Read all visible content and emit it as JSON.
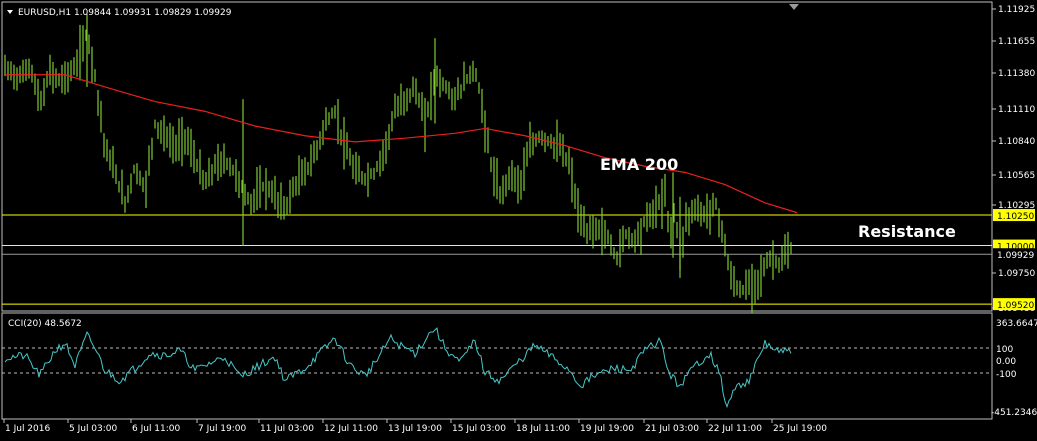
{
  "header": {
    "symbol_line": "EURUSD,H1  1.09844 1.09931 1.09829 1.09929"
  },
  "indicator": {
    "label": "CCI(20) 48.5672",
    "levels": [
      "100",
      "0.00",
      "-100"
    ],
    "scale_top": "363.6647",
    "scale_bottom": "-451.2346"
  },
  "annotations": {
    "ema": "EMA 200",
    "resistance": "Resistance"
  },
  "price_axis": {
    "ticks": [
      "1.11925",
      "1.11655",
      "1.11380",
      "1.11110",
      "1.10840",
      "1.10565",
      "1.10295",
      "1.09750",
      "1.09480"
    ],
    "highlight_labels": [
      {
        "text": "1.10250",
        "value": 1.1025
      },
      {
        "text": "1.10000",
        "value": 1.1
      },
      {
        "text": "1.09520",
        "value": 1.0952
      }
    ],
    "current_label": {
      "text": "1.09929",
      "value": 1.09929
    }
  },
  "time_axis": {
    "labels": [
      "1 Jul 2016",
      "5 Jul 03:00",
      "6 Jul 11:00",
      "7 Jul 19:00",
      "11 Jul 03:00",
      "12 Jul 11:00",
      "13 Jul 19:00",
      "15 Jul 03:00",
      "18 Jul 11:00",
      "19 Jul 19:00",
      "21 Jul 03:00",
      "22 Jul 11:00",
      "25 Jul 19:00"
    ]
  },
  "colors": {
    "background": "#000000",
    "candles": "#7FC832",
    "ema": "#E8201E",
    "level_lines": "#FFFF00",
    "current_line": "#9A9A9A",
    "cci": "#46C8C8",
    "text": "#FFFFFF",
    "grid_border": "#C0C0C0"
  },
  "chart_data": {
    "type": "line",
    "price_range": [
      1.0948,
      1.1198
    ],
    "horizontal_levels": [
      1.1025,
      1.1,
      1.0952
    ],
    "current_price": 1.09929,
    "price_path": [
      [
        0,
        1.1145
      ],
      [
        15,
        1.1138
      ],
      [
        25,
        1.1148
      ],
      [
        35,
        1.1115
      ],
      [
        45,
        1.1142
      ],
      [
        55,
        1.1135
      ],
      [
        70,
        1.1145
      ],
      [
        82,
        1.1175
      ],
      [
        90,
        1.114
      ],
      [
        100,
        1.108
      ],
      [
        110,
        1.106
      ],
      [
        120,
        1.1035
      ],
      [
        130,
        1.1065
      ],
      [
        140,
        1.1045
      ],
      [
        150,
        1.11
      ],
      [
        160,
        1.109
      ],
      [
        170,
        1.108
      ],
      [
        180,
        1.109
      ],
      [
        190,
        1.107
      ],
      [
        200,
        1.105
      ],
      [
        210,
        1.1065
      ],
      [
        220,
        1.107
      ],
      [
        230,
        1.106
      ],
      [
        238,
        1.1045
      ],
      [
        245,
        1.1035
      ],
      [
        260,
        1.105
      ],
      [
        270,
        1.104
      ],
      [
        280,
        1.103
      ],
      [
        290,
        1.105
      ],
      [
        300,
        1.106
      ],
      [
        310,
        1.1075
      ],
      [
        320,
        1.11
      ],
      [
        330,
        1.111
      ],
      [
        340,
        1.108
      ],
      [
        350,
        1.106
      ],
      [
        360,
        1.1055
      ],
      [
        370,
        1.106
      ],
      [
        380,
        1.108
      ],
      [
        390,
        1.111
      ],
      [
        400,
        1.112
      ],
      [
        410,
        1.113
      ],
      [
        420,
        1.11
      ],
      [
        430,
        1.114
      ],
      [
        440,
        1.113
      ],
      [
        450,
        1.112
      ],
      [
        460,
        1.1135
      ],
      [
        470,
        1.1145
      ],
      [
        478,
        1.111
      ],
      [
        485,
        1.107
      ],
      [
        495,
        1.104
      ],
      [
        505,
        1.106
      ],
      [
        515,
        1.105
      ],
      [
        525,
        1.108
      ],
      [
        535,
        1.109
      ],
      [
        545,
        1.1085
      ],
      [
        555,
        1.108
      ],
      [
        565,
        1.1065
      ],
      [
        572,
        1.103
      ],
      [
        580,
        1.101
      ],
      [
        590,
        1.1015
      ],
      [
        600,
        1.101
      ],
      [
        612,
        1.099
      ],
      [
        620,
        1.101
      ],
      [
        630,
        1.1005
      ],
      [
        640,
        1.102
      ],
      [
        650,
        1.103
      ],
      [
        660,
        1.104
      ],
      [
        665,
        1.101
      ],
      [
        670,
        1.103
      ],
      [
        675,
        1.099
      ],
      [
        680,
        1.102
      ],
      [
        690,
        1.103
      ],
      [
        700,
        1.1025
      ],
      [
        710,
        1.1035
      ],
      [
        718,
        1.101
      ],
      [
        725,
        1.0975
      ],
      [
        735,
        1.0962
      ],
      [
        745,
        1.0968
      ],
      [
        755,
        1.0975
      ],
      [
        765,
        1.099
      ],
      [
        775,
        1.0985
      ],
      [
        785,
        1.0997
      ],
      [
        792,
        1.0993
      ]
    ],
    "ema_path": [
      [
        0,
        1.114
      ],
      [
        60,
        1.114
      ],
      [
        100,
        1.113
      ],
      [
        150,
        1.1118
      ],
      [
        200,
        1.111
      ],
      [
        250,
        1.1098
      ],
      [
        300,
        1.109
      ],
      [
        350,
        1.1085
      ],
      [
        400,
        1.1088
      ],
      [
        450,
        1.1092
      ],
      [
        480,
        1.1096
      ],
      [
        520,
        1.109
      ],
      [
        560,
        1.1082
      ],
      [
        600,
        1.1072
      ],
      [
        640,
        1.1065
      ],
      [
        680,
        1.106
      ],
      [
        720,
        1.105
      ],
      [
        760,
        1.1035
      ],
      [
        792,
        1.1027
      ]
    ],
    "cci_range": [
      -451.2346,
      363.6647
    ],
    "cci_levels": [
      100,
      0,
      -100
    ],
    "cci_path": [
      [
        0,
        20
      ],
      [
        20,
        40
      ],
      [
        35,
        -120
      ],
      [
        50,
        80
      ],
      [
        60,
        140
      ],
      [
        70,
        -40
      ],
      [
        82,
        200
      ],
      [
        90,
        100
      ],
      [
        100,
        -80
      ],
      [
        115,
        -160
      ],
      [
        130,
        -60
      ],
      [
        145,
        60
      ],
      [
        160,
        40
      ],
      [
        175,
        80
      ],
      [
        190,
        -80
      ],
      [
        205,
        -20
      ],
      [
        220,
        30
      ],
      [
        235,
        -130
      ],
      [
        250,
        -60
      ],
      [
        270,
        30
      ],
      [
        280,
        -160
      ],
      [
        300,
        -60
      ],
      [
        320,
        100
      ],
      [
        330,
        180
      ],
      [
        345,
        -40
      ],
      [
        360,
        -120
      ],
      [
        375,
        40
      ],
      [
        385,
        180
      ],
      [
        395,
        120
      ],
      [
        410,
        60
      ],
      [
        425,
        220
      ],
      [
        430,
        260
      ],
      [
        440,
        100
      ],
      [
        455,
        -20
      ],
      [
        470,
        160
      ],
      [
        480,
        -100
      ],
      [
        495,
        -160
      ],
      [
        510,
        -40
      ],
      [
        530,
        120
      ],
      [
        545,
        40
      ],
      [
        565,
        -80
      ],
      [
        575,
        -200
      ],
      [
        590,
        -120
      ],
      [
        610,
        -60
      ],
      [
        625,
        -80
      ],
      [
        640,
        80
      ],
      [
        655,
        160
      ],
      [
        665,
        -120
      ],
      [
        675,
        -200
      ],
      [
        690,
        -40
      ],
      [
        705,
        60
      ],
      [
        715,
        -120
      ],
      [
        722,
        -380
      ],
      [
        730,
        -220
      ],
      [
        745,
        -150
      ],
      [
        760,
        140
      ],
      [
        775,
        60
      ],
      [
        785,
        80
      ],
      [
        792,
        48.5672
      ]
    ]
  }
}
